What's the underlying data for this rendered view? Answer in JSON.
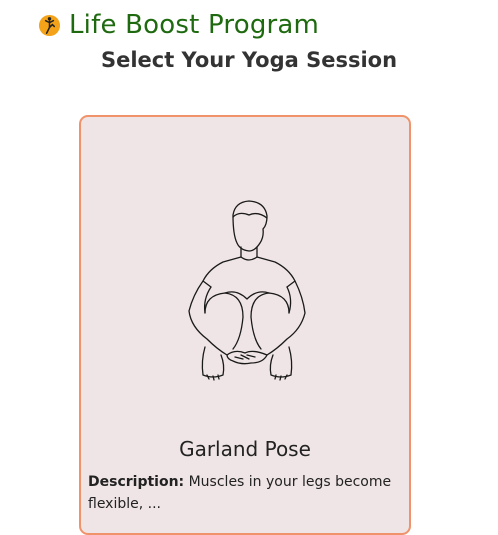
{
  "header": {
    "logo_icon": "yoga-pose-logo-icon",
    "title": "Life Boost Program"
  },
  "page": {
    "subtitle": "Select Your Yoga Session"
  },
  "card": {
    "image_icon": "garland-pose-illustration",
    "pose_name": "Garland Pose",
    "description_label": "Description:",
    "description_text": " Muscles in your legs become flexible, ..."
  },
  "colors": {
    "title": "#1f6a10",
    "card_background": "#efe5e6",
    "card_border": "#f0936a"
  }
}
